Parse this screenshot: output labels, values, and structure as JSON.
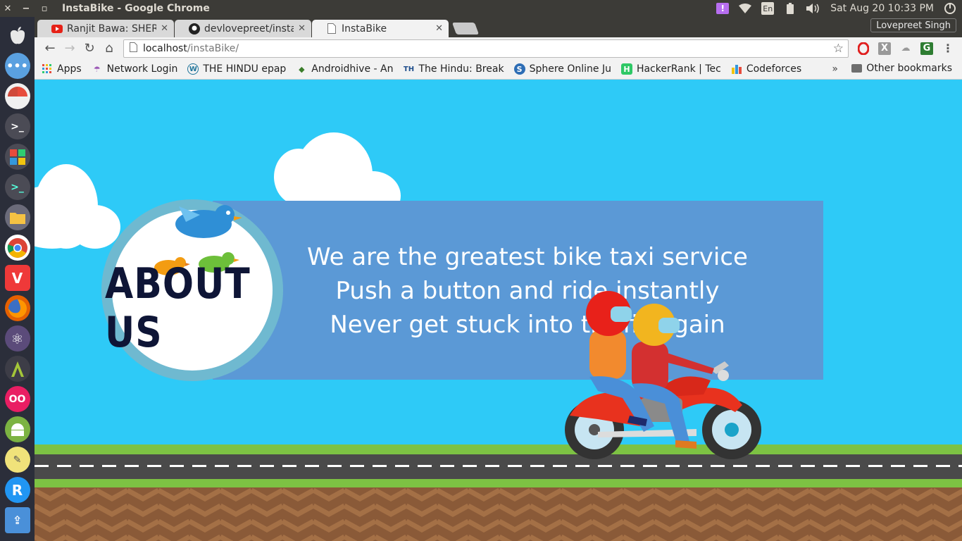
{
  "system": {
    "window_title": "InstaBike - Google Chrome",
    "clock": "Sat Aug 20 10:33 PM",
    "lang": "En"
  },
  "tabs": [
    {
      "label": "Ranjit Bawa: SHER",
      "icon": "youtube-icon"
    },
    {
      "label": "devlovepreet/insta",
      "icon": "github-icon"
    },
    {
      "label": "InstaBike",
      "icon": "page-icon"
    }
  ],
  "profile": "Lovepreet Singh",
  "omnibox": {
    "host": "localhost",
    "path": "/instaBike/"
  },
  "bookmarks": [
    {
      "label": "Apps",
      "icon": "apps-grid-icon"
    },
    {
      "label": "Network Login",
      "icon": "umbrella-icon"
    },
    {
      "label": "THE HINDU epap",
      "icon": "wordpress-icon"
    },
    {
      "label": "Androidhive - An",
      "icon": "androidhive-icon"
    },
    {
      "label": "The Hindu: Break",
      "icon": "the-hindu-icon"
    },
    {
      "label": "Sphere Online Ju",
      "icon": "spoj-icon"
    },
    {
      "label": "HackerRank | Tec",
      "icon": "hackerrank-icon"
    },
    {
      "label": "Codeforces",
      "icon": "codeforces-icon"
    }
  ],
  "bookmarks_more": "»",
  "other_bookmarks": "Other bookmarks",
  "page": {
    "badge_text": "ABOUT US",
    "lines": [
      "We are the greatest bike taxi service",
      "Push a button and ride instantly",
      "Never get stuck into traffic again"
    ]
  }
}
